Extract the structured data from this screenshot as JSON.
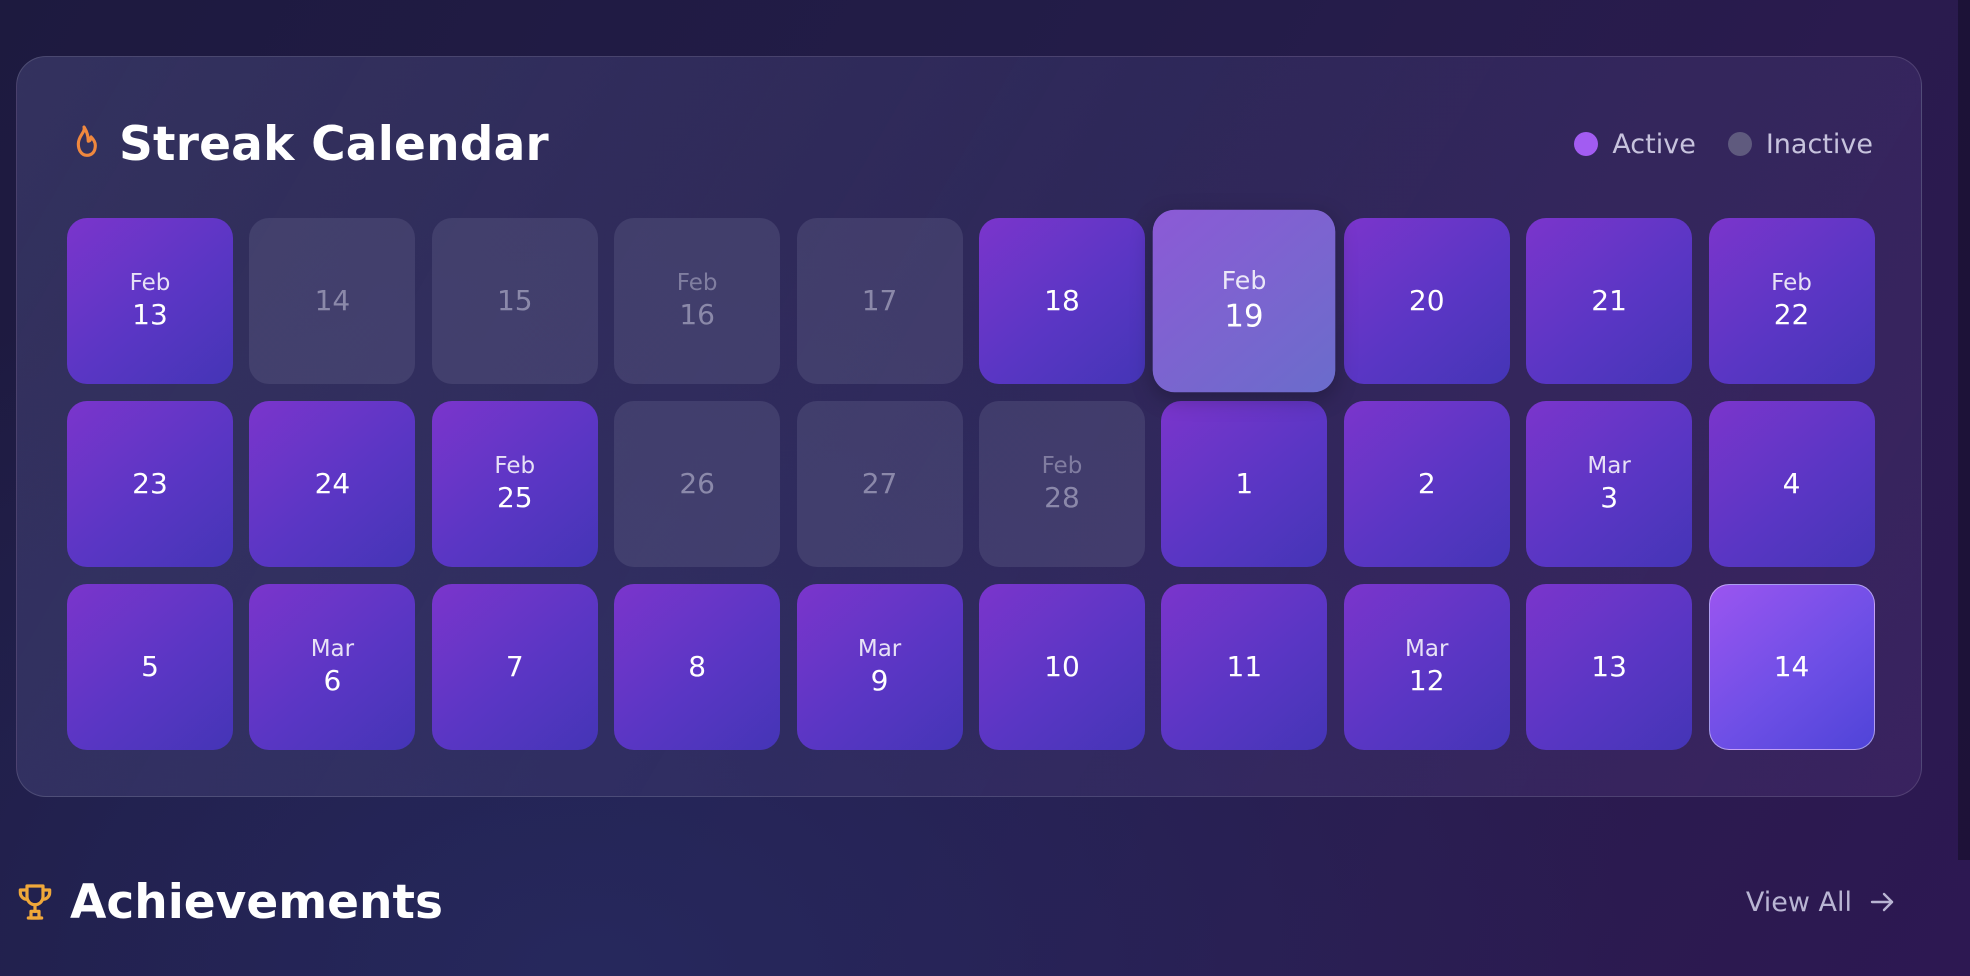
{
  "streak": {
    "title": "Streak Calendar",
    "icon": "flame-icon",
    "icon_color": "#f0883e",
    "legend": {
      "active": "Active",
      "inactive": "Inactive",
      "active_color": "#a25cf2",
      "inactive_color": "#5f5a7e"
    },
    "days": [
      {
        "month": "Feb",
        "day": "13",
        "status": "active"
      },
      {
        "month": "",
        "day": "14",
        "status": "inactive"
      },
      {
        "month": "",
        "day": "15",
        "status": "inactive"
      },
      {
        "month": "Feb",
        "day": "16",
        "status": "inactive"
      },
      {
        "month": "",
        "day": "17",
        "status": "inactive"
      },
      {
        "month": "",
        "day": "18",
        "status": "active"
      },
      {
        "month": "Feb",
        "day": "19",
        "status": "active",
        "highlight": true
      },
      {
        "month": "",
        "day": "20",
        "status": "active"
      },
      {
        "month": "",
        "day": "21",
        "status": "active"
      },
      {
        "month": "Feb",
        "day": "22",
        "status": "active"
      },
      {
        "month": "",
        "day": "23",
        "status": "active"
      },
      {
        "month": "",
        "day": "24",
        "status": "active"
      },
      {
        "month": "Feb",
        "day": "25",
        "status": "active"
      },
      {
        "month": "",
        "day": "26",
        "status": "inactive"
      },
      {
        "month": "",
        "day": "27",
        "status": "inactive"
      },
      {
        "month": "Feb",
        "day": "28",
        "status": "inactive"
      },
      {
        "month": "",
        "day": "1",
        "status": "active"
      },
      {
        "month": "",
        "day": "2",
        "status": "active"
      },
      {
        "month": "Mar",
        "day": "3",
        "status": "active"
      },
      {
        "month": "",
        "day": "4",
        "status": "active"
      },
      {
        "month": "",
        "day": "5",
        "status": "active"
      },
      {
        "month": "Mar",
        "day": "6",
        "status": "active"
      },
      {
        "month": "",
        "day": "7",
        "status": "active"
      },
      {
        "month": "",
        "day": "8",
        "status": "active"
      },
      {
        "month": "Mar",
        "day": "9",
        "status": "active"
      },
      {
        "month": "",
        "day": "10",
        "status": "active"
      },
      {
        "month": "",
        "day": "11",
        "status": "active"
      },
      {
        "month": "Mar",
        "day": "12",
        "status": "active"
      },
      {
        "month": "",
        "day": "13",
        "status": "active"
      },
      {
        "month": "",
        "day": "14",
        "status": "active",
        "last": true
      }
    ]
  },
  "achievements": {
    "title": "Achievements",
    "icon": "trophy-icon",
    "icon_color": "#f0a83a",
    "view_all": "View All"
  }
}
